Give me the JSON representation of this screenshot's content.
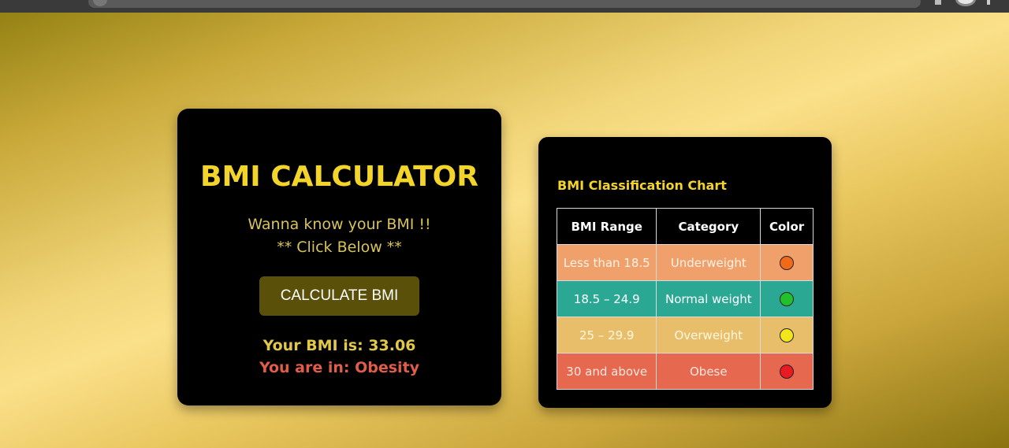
{
  "calculator": {
    "title": "BMI CALCULATOR",
    "subtitle_line1": "Wanna know your BMI !!",
    "subtitle_line2": "** Click Below **",
    "button_label": "CALCULATE BMI",
    "result_bmi": "Your BMI is: 33.06",
    "result_category": "You are in: Obesity"
  },
  "chart": {
    "title": "BMI Classification Chart",
    "headers": [
      "BMI Range",
      "Category",
      "Color"
    ],
    "rows": [
      {
        "range": "Less than 18.5",
        "category": "Underweight",
        "color": "#f06a1a"
      },
      {
        "range": "18.5 – 24.9",
        "category": "Normal weight",
        "color": "#22c02a"
      },
      {
        "range": "25 – 29.9",
        "category": "Overweight",
        "color": "#f2e51a"
      },
      {
        "range": "30 and above",
        "category": "Obese",
        "color": "#e81a22"
      }
    ]
  }
}
